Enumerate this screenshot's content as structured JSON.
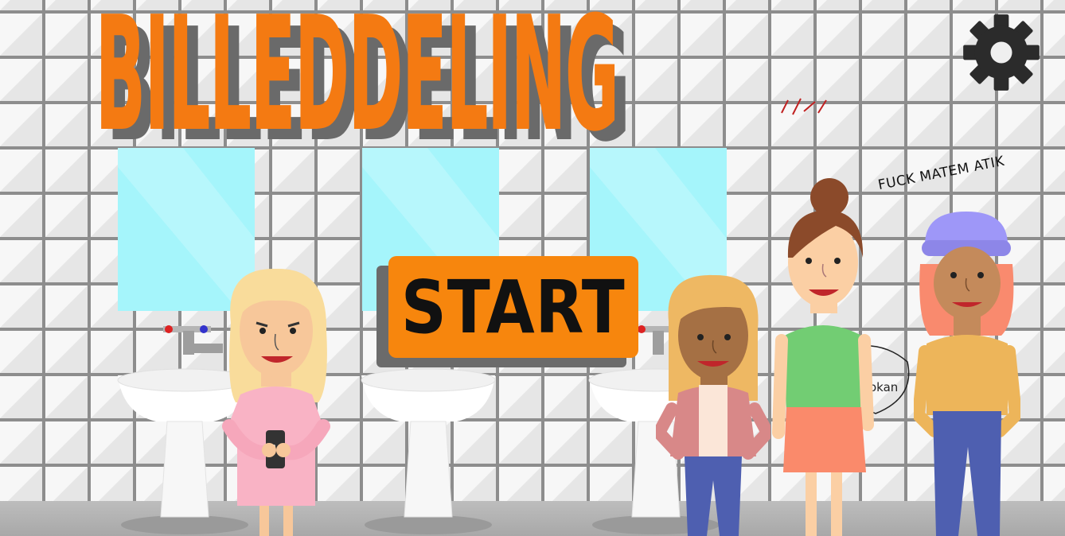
{
  "game": {
    "title": "BILLEDDELING",
    "graffiti": "FUCK MATEM ATIK",
    "start_label": "START"
  },
  "icons": {
    "settings": "gear-icon"
  },
  "colors": {
    "accent": "#f47a12",
    "start_button": "#f7860d",
    "tile_light": "#f4f4f4",
    "tile_grout": "#9a9a9a",
    "mirror": "#a5f5fb"
  }
}
